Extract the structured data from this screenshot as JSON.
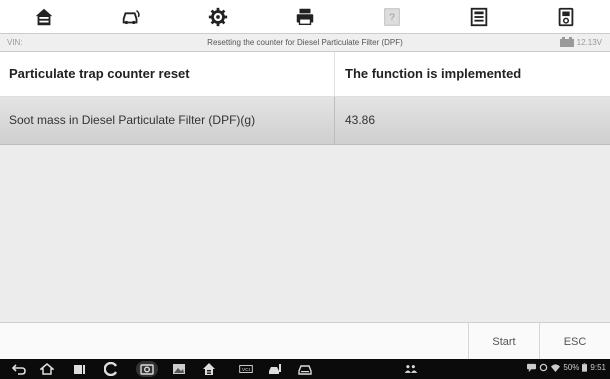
{
  "toolbar": {
    "buttons": [
      {
        "icon": "home-icon"
      },
      {
        "icon": "vehicle-swap-icon"
      },
      {
        "icon": "settings-gear-icon"
      },
      {
        "icon": "print-icon"
      },
      {
        "icon": "help-icon"
      },
      {
        "icon": "save-data-icon"
      },
      {
        "icon": "datalogging-icon"
      }
    ]
  },
  "info_bar": {
    "vin_label": "VIN:",
    "title": "Resetting the counter for Diesel Particulate Filter (DPF)",
    "voltage": "12.13V"
  },
  "table": {
    "header": {
      "col1": "Particulate trap counter reset",
      "col2": "The function is implemented"
    },
    "rows": [
      {
        "name": "Soot mass in Diesel Particulate Filter (DPF)(g)",
        "value": "43.86"
      }
    ]
  },
  "footer": {
    "start_label": "Start",
    "esc_label": "ESC"
  },
  "status_bar": {
    "battery": "50%",
    "time": "9:51"
  },
  "colors": {
    "toolbar_icon": "#222222",
    "selected_row": "#d8d8d8",
    "content_bg": "#ececec",
    "nav_bg": "#0b0b0b"
  }
}
